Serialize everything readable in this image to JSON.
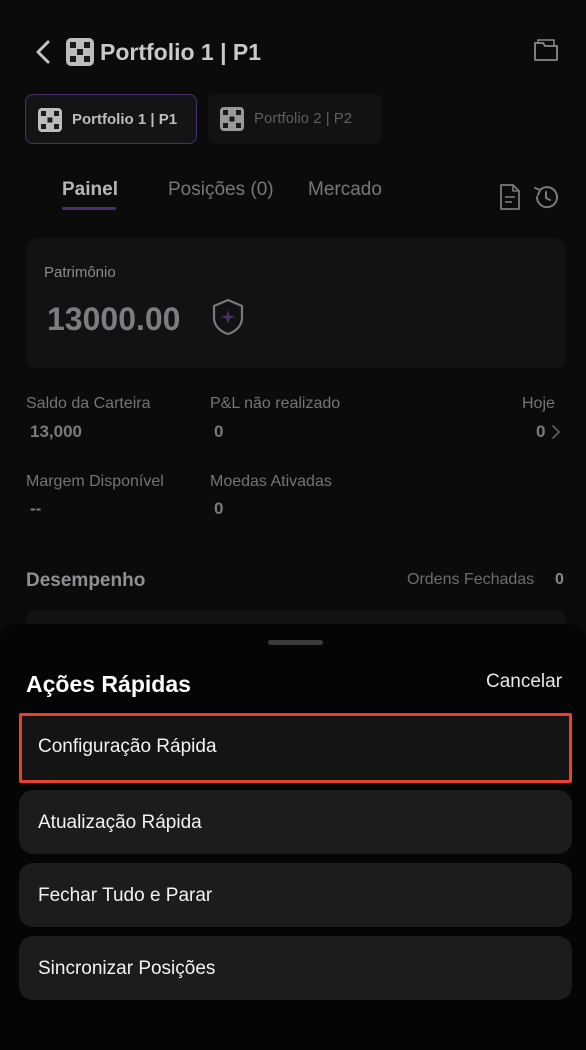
{
  "header": {
    "title": "Portfolio 1 | P1",
    "icons": [
      "back-arrow-icon",
      "portfolio-logo-icon",
      "folder-icon"
    ]
  },
  "portfolios": [
    {
      "label": "Portfolio 1 | P1",
      "active": true
    },
    {
      "label": "Portfolio 2 | P2",
      "active": false
    }
  ],
  "tabs": [
    {
      "label": "Painel",
      "active": true
    },
    {
      "label": "Posições (0)",
      "active": false
    },
    {
      "label": "Mercado",
      "active": false
    }
  ],
  "equity": {
    "label": "Patrimônio",
    "value": "13000.00"
  },
  "stats": {
    "wallet_balance": {
      "label": "Saldo da Carteira",
      "value": "13,000"
    },
    "unrealized_pnl": {
      "label": "P&L não realizado",
      "value": "0"
    },
    "today": {
      "label": "Hoje",
      "value": "0"
    },
    "available_margin": {
      "label": "Margem Disponível",
      "value": "--"
    },
    "active_coins": {
      "label": "Moedas Ativadas",
      "value": "0"
    }
  },
  "performance": {
    "title": "Desempenho",
    "closed_orders_label": "Ordens Fechadas",
    "closed_orders_count": "0"
  },
  "sheet": {
    "title": "Ações Rápidas",
    "cancel_label": "Cancelar",
    "actions": [
      {
        "label": "Configuração Rápida",
        "highlighted": true
      },
      {
        "label": "Atualização Rápida",
        "highlighted": false
      },
      {
        "label": "Fechar Tudo e Parar",
        "highlighted": false
      },
      {
        "label": "Sincronizar Posições",
        "highlighted": false
      }
    ]
  },
  "colors": {
    "accent_purple": "#4b2e6b",
    "highlight_red": "#e8412e",
    "sheet_item_bg": "#1c1c1e"
  }
}
